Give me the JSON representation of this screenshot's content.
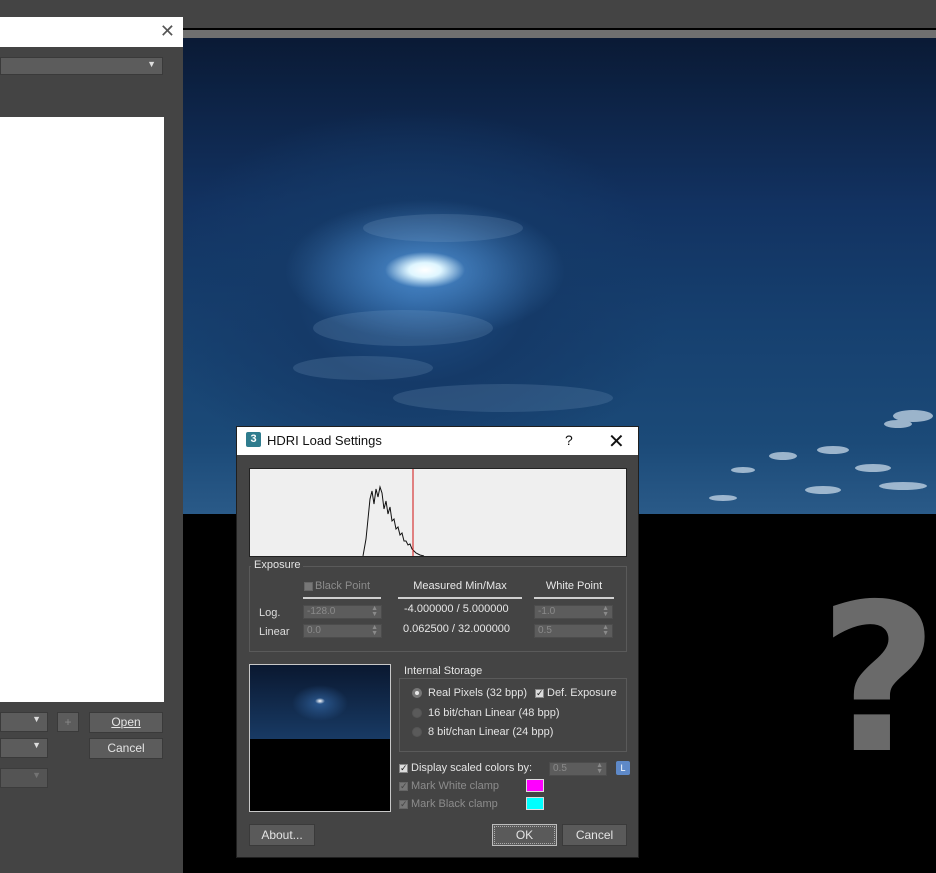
{
  "file_dialog": {
    "close_glyph": "✕",
    "open_button": "Open",
    "cancel_button": "Cancel",
    "add_glyph": "+"
  },
  "dialog": {
    "title": "HDRI Load Settings",
    "icon_glyph": "3",
    "help_glyph": "?",
    "close_glyph": "✕",
    "exposure": {
      "group_label": "Exposure",
      "black_point_label": "Black Point",
      "measured_label": "Measured Min/Max",
      "white_point_label": "White Point",
      "log_label": "Log.",
      "linear_label": "Linear",
      "black_log": "-128.0",
      "black_linear": "0.0",
      "measured_log": "-4.000000 / 5.000000",
      "measured_linear": "0.062500 / 32.000000",
      "white_log": "-1.0",
      "white_linear": "0.5"
    },
    "storage": {
      "group_label": "Internal Storage",
      "options": [
        {
          "label": "Real Pixels (32 bpp)",
          "selected": true
        },
        {
          "label": "16 bit/chan Linear (48 bpp)",
          "selected": false
        },
        {
          "label": "8 bit/chan Linear (24 bpp)",
          "selected": false
        }
      ],
      "def_exposure_label": "Def. Exposure",
      "def_exposure_checked": true
    },
    "display_scaled_label": "Display scaled colors by:",
    "display_scaled_checked": true,
    "display_scaled_value": "0.5",
    "lock_glyph": "L",
    "mark_white_label": "Mark White clamp",
    "mark_white_color": "#ff00ff",
    "mark_black_label": "Mark Black clamp",
    "mark_black_color": "#00ffff",
    "about_button": "About...",
    "ok_button": "OK",
    "cancel_button": "Cancel"
  },
  "viewport": {
    "overlay_glyph": "?"
  }
}
